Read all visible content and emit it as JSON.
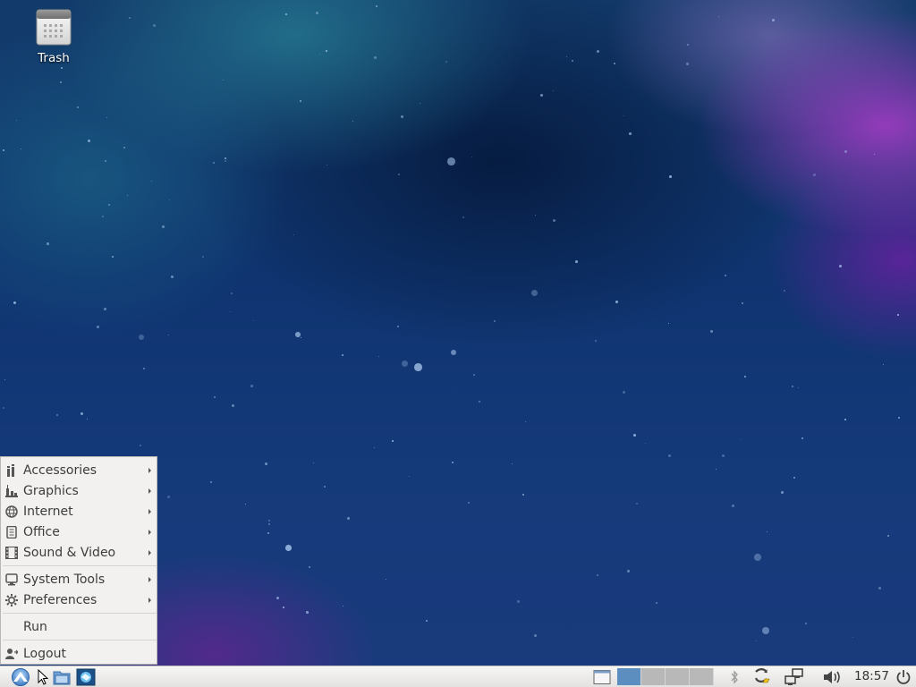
{
  "desktop": {
    "icons": [
      {
        "label": "Trash",
        "icon": "trash-icon"
      }
    ]
  },
  "menu": {
    "items": [
      {
        "label": "Accessories",
        "icon": "accessories-icon",
        "submenu": true
      },
      {
        "label": "Graphics",
        "icon": "graphics-icon",
        "submenu": true
      },
      {
        "label": "Internet",
        "icon": "internet-icon",
        "submenu": true
      },
      {
        "label": "Office",
        "icon": "office-icon",
        "submenu": true
      },
      {
        "label": "Sound & Video",
        "icon": "sound-video-icon",
        "submenu": true
      },
      {
        "label": "System Tools",
        "icon": "system-tools-icon",
        "submenu": true
      },
      {
        "label": "Preferences",
        "icon": "preferences-icon",
        "submenu": true
      },
      {
        "label": "Run",
        "icon": "",
        "submenu": false
      },
      {
        "label": "Logout",
        "icon": "logout-icon",
        "submenu": false
      }
    ]
  },
  "panel": {
    "launchers": [
      "start-menu-icon",
      "file-manager-icon",
      "browser-icon"
    ],
    "workspaces": {
      "count": 4,
      "active": 1
    },
    "tray": [
      "bluetooth-icon",
      "update-notifier-icon",
      "network-icon",
      "volume-icon"
    ],
    "clock": "18:57",
    "power": "power-icon"
  },
  "colors": {
    "panel_bg": "#e3e2e0",
    "menu_bg": "#f2f1f0",
    "workspace_active": "#5c8ec0"
  }
}
